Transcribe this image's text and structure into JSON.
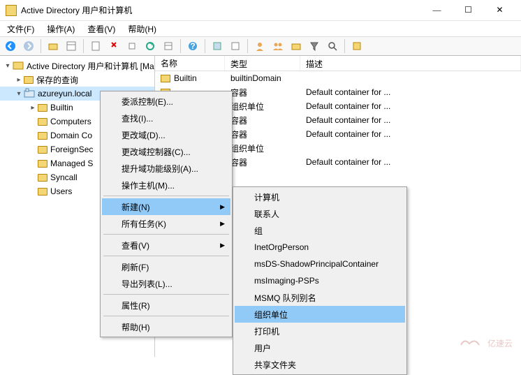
{
  "window": {
    "title": "Active Directory 用户和计算机",
    "min": "—",
    "max": "☐",
    "close": "✕"
  },
  "menu": {
    "file": "文件(F)",
    "action": "操作(A)",
    "view": "查看(V)",
    "help": "帮助(H)"
  },
  "tree": {
    "root": "Active Directory 用户和计算机 [Ma",
    "saved": "保存的查询",
    "domain": "azureyun.local",
    "children": [
      "Builtin",
      "Computers",
      "Domain Co",
      "ForeignSec",
      "Managed S",
      "Syncall",
      "Users"
    ]
  },
  "list": {
    "headers": {
      "name": "名称",
      "type": "类型",
      "desc": "描述"
    },
    "rows": [
      {
        "name": "Builtin",
        "type": "builtinDomain",
        "desc": ""
      },
      {
        "name": "",
        "type": "容器",
        "desc": "Default container for ..."
      },
      {
        "name": "",
        "type": "组织单位",
        "desc": "Default container for ..."
      },
      {
        "name": "",
        "type": "容器",
        "desc": "Default container for ..."
      },
      {
        "name": "",
        "type": "容器",
        "desc": "Default container for ..."
      },
      {
        "name": "",
        "type": "组织单位",
        "desc": ""
      },
      {
        "name": "",
        "type": "容器",
        "desc": "Default container for ..."
      }
    ]
  },
  "ctx1": {
    "items": [
      "委派控制(E)...",
      "查找(I)...",
      "更改域(D)...",
      "更改域控制器(C)...",
      "提升域功能级别(A)...",
      "操作主机(M)..."
    ],
    "new": "新建(N)",
    "tasks": "所有任务(K)",
    "view": "查看(V)",
    "refresh": "刷新(F)",
    "export": "导出列表(L)...",
    "props": "属性(R)",
    "help": "帮助(H)"
  },
  "ctx2": {
    "items": [
      "计算机",
      "联系人",
      "组",
      "InetOrgPerson",
      "msDS-ShadowPrincipalContainer",
      "msImaging-PSPs",
      "MSMQ 队列别名",
      "组织单位",
      "打印机",
      "用户",
      "共享文件夹"
    ],
    "highlight_index": 7
  },
  "watermark": "亿速云"
}
